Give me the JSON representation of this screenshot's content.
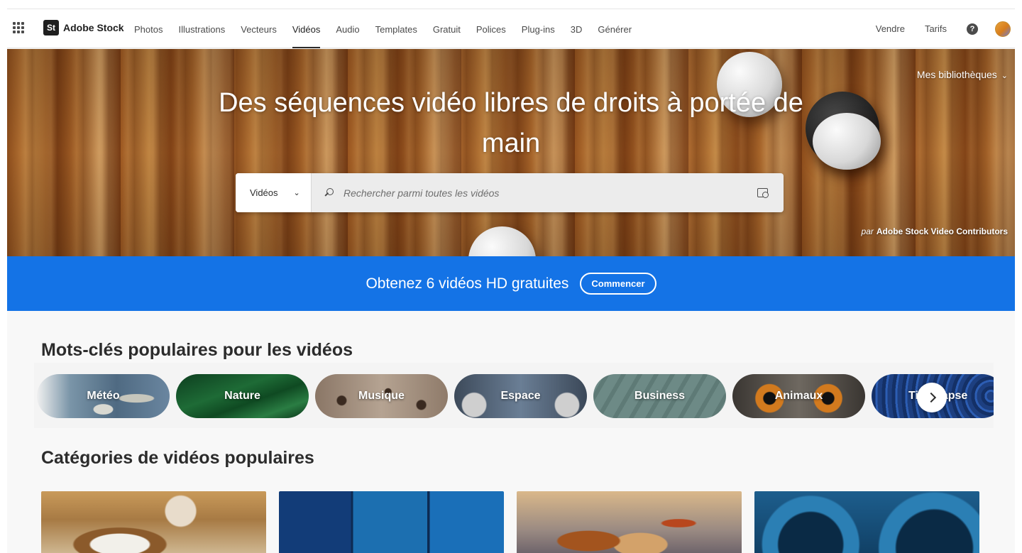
{
  "brand": {
    "logo_mark": "St",
    "name": "Adobe Stock"
  },
  "nav": {
    "items": [
      "Photos",
      "Illustrations",
      "Vecteurs",
      "Vidéos",
      "Audio",
      "Templates",
      "Gratuit",
      "Polices",
      "Plug-ins",
      "3D",
      "Générer"
    ],
    "active": "Vidéos",
    "right": {
      "sell": "Vendre",
      "pricing": "Tarifs",
      "help_icon": "help-icon",
      "avatar": "user-avatar"
    }
  },
  "hero": {
    "title": "Des séquences vidéo libres de droits à portée de main",
    "libraries": "Mes bibliothèques",
    "credit_prefix": "par",
    "credit_name": "Adobe Stock Video Contributors",
    "search": {
      "type_label": "Vidéos",
      "placeholder": "Rechercher parmi toutes les vidéos"
    }
  },
  "promo": {
    "text": "Obtenez 6 vidéos HD gratuites",
    "button": "Commencer",
    "color": "#1473e6"
  },
  "keywords": {
    "title": "Mots-clés populaires pour les vidéos",
    "items": [
      "Météo",
      "Nature",
      "Musique",
      "Espace",
      "Business",
      "Animaux",
      "Time-lapse"
    ]
  },
  "categories": {
    "title": "Catégories de vidéos populaires"
  }
}
